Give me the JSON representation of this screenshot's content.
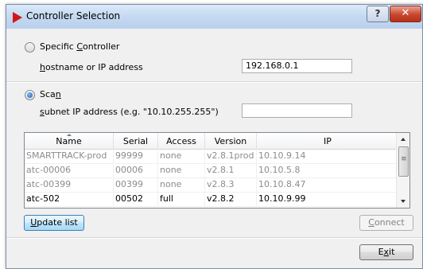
{
  "window": {
    "title": "Controller Selection"
  },
  "titlebar": {
    "help_label": "?",
    "close_label": "✕"
  },
  "specific": {
    "label_pre": "Specific ",
    "label_key": "C",
    "label_post": "ontroller",
    "selected": false
  },
  "hostname": {
    "label_key": "h",
    "label_post": "ostname or IP address",
    "value": "192.168.0.1"
  },
  "scan": {
    "label_pre": "Sca",
    "label_key": "n",
    "selected": true
  },
  "subnet": {
    "label_key": "s",
    "label_post": "ubnet IP address (e.g. \"10.10.255.255\")",
    "value": ""
  },
  "table": {
    "columns": [
      "Name",
      "Serial",
      "Access",
      "Version",
      "IP"
    ],
    "rows": [
      {
        "name": "SMARTTRACK-prod",
        "serial": "99999",
        "access": "none",
        "version": "v2.8.1prod",
        "ip": "10.10.9.14",
        "dim": true
      },
      {
        "name": "atc-00006",
        "serial": "00006",
        "access": "none",
        "version": "v2.8.1",
        "ip": "10.10.5.8",
        "dim": true
      },
      {
        "name": "atc-00399",
        "serial": "00399",
        "access": "none",
        "version": "v2.8.3",
        "ip": "10.10.8.47",
        "dim": true
      },
      {
        "name": "atc-502",
        "serial": "00502",
        "access": "full",
        "version": "v2.8.2",
        "ip": "10.10.9.99",
        "dim": false
      }
    ]
  },
  "buttons": {
    "update": {
      "key": "U",
      "rest": "pdate list"
    },
    "connect": {
      "key": "C",
      "rest": "onnect"
    },
    "exit": {
      "pre": "E",
      "key": "x",
      "rest": "it"
    }
  }
}
